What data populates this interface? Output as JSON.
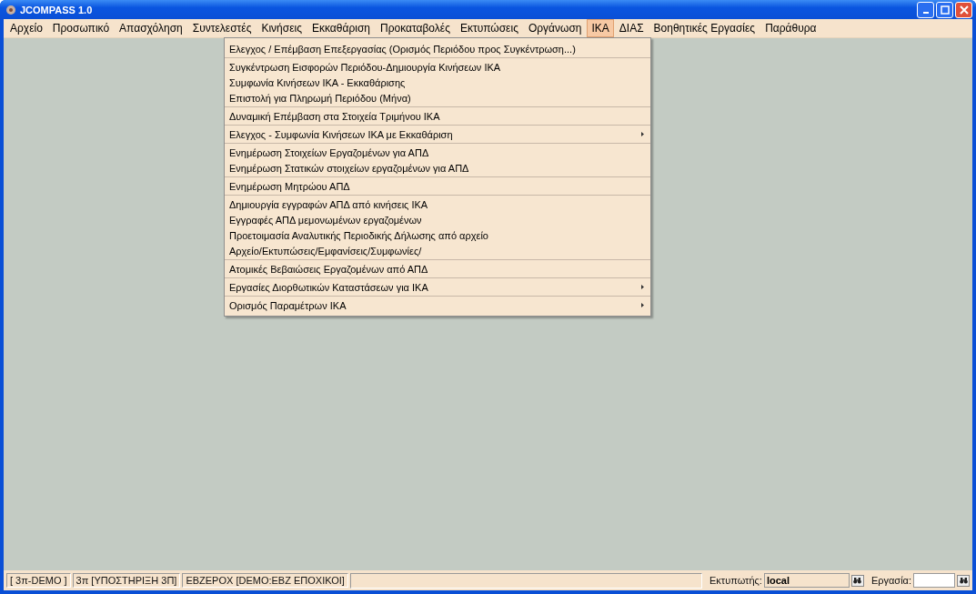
{
  "window": {
    "title": "JCOMPASS 1.0"
  },
  "menubar": [
    {
      "label": "Αρχείο",
      "selected": false
    },
    {
      "label": "Προσωπικό",
      "selected": false
    },
    {
      "label": "Απασχόληση",
      "selected": false
    },
    {
      "label": "Συντελεστές",
      "selected": false
    },
    {
      "label": "Κινήσεις",
      "selected": false
    },
    {
      "label": "Εκκαθάριση",
      "selected": false
    },
    {
      "label": "Προκαταβολές",
      "selected": false
    },
    {
      "label": "Εκτυπώσεις",
      "selected": false
    },
    {
      "label": "Οργάνωση",
      "selected": false
    },
    {
      "label": "ΙΚΑ",
      "selected": true
    },
    {
      "label": "ΔΙΑΣ",
      "selected": false
    },
    {
      "label": "Βοηθητικές Εργασίες",
      "selected": false
    },
    {
      "label": "Παράθυρα",
      "selected": false
    }
  ],
  "menu_groups": [
    [
      {
        "label": "Ελεγχος / Επέμβαση Επεξεργασίας (Ορισμός Περιόδου προς Συγκέντρωση...)",
        "submenu": false
      }
    ],
    [
      {
        "label": "Συγκέντρωση Εισφορών Περιόδου-Δημιουργία Κινήσεων ΙΚΑ",
        "submenu": false
      },
      {
        "label": "Συμφωνία Κινήσεων ΙΚΑ - Εκκαθάρισης",
        "submenu": false
      },
      {
        "label": "Επιστολή για Πληρωμή Περιόδου (Μήνα)",
        "submenu": false
      }
    ],
    [
      {
        "label": "Δυναμική Επέμβαση στα Στοιχεία Τριμήνου ΙΚΑ",
        "submenu": false
      }
    ],
    [
      {
        "label": "Ελεγχος - Συμφωνία Κινήσεων ΙΚΑ με Εκκαθάριση",
        "submenu": true
      }
    ],
    [
      {
        "label": "Ενημέρωση Στοιχείων Εργαζομένων για ΑΠΔ",
        "submenu": false
      },
      {
        "label": "Ενημέρωση Στατικών στοιχείων εργαζομένων για ΑΠΔ",
        "submenu": false
      }
    ],
    [
      {
        "label": "Ενημέρωση Μητρώου ΑΠΔ",
        "submenu": false
      }
    ],
    [
      {
        "label": "Δημιουργία εγγραφών ΑΠΔ από κινήσεις ΙΚΑ",
        "submenu": false
      },
      {
        "label": "Εγγραφές ΑΠΔ μεμονωμένων εργαζομένων",
        "submenu": false
      },
      {
        "label": "Προετοιμασία Αναλυτικής Περιοδικής Δήλωσης από αρχείο",
        "submenu": false
      },
      {
        "label": "Αρχείο/Εκτυπώσεις/Εμφανίσεις/Συμφωνίες/",
        "submenu": false
      }
    ],
    [
      {
        "label": "Ατομικές Βεβαιώσεις Εργαζομένων από ΑΠΔ",
        "submenu": false
      }
    ],
    [
      {
        "label": "Εργασίες Διορθωτικών Καταστάσεων για ΙΚΑ",
        "submenu": true
      }
    ],
    [
      {
        "label": "Ορισμός Παραμέτρων ΙΚΑ",
        "submenu": true
      }
    ]
  ],
  "status_bar": {
    "panels": [
      "[ 3π-DEMO ]",
      "3π [ΥΠΟΣΤΗΡΙΞΗ 3Π]",
      "ΕΒΖΕΡΟΧ [DEMO:ΕΒΖ ΕΠΟΧΙΚΟΙ]"
    ],
    "printer": {
      "label": "Εκτυπωτής:",
      "value": "local"
    },
    "job": {
      "label": "Εργασία:"
    }
  }
}
